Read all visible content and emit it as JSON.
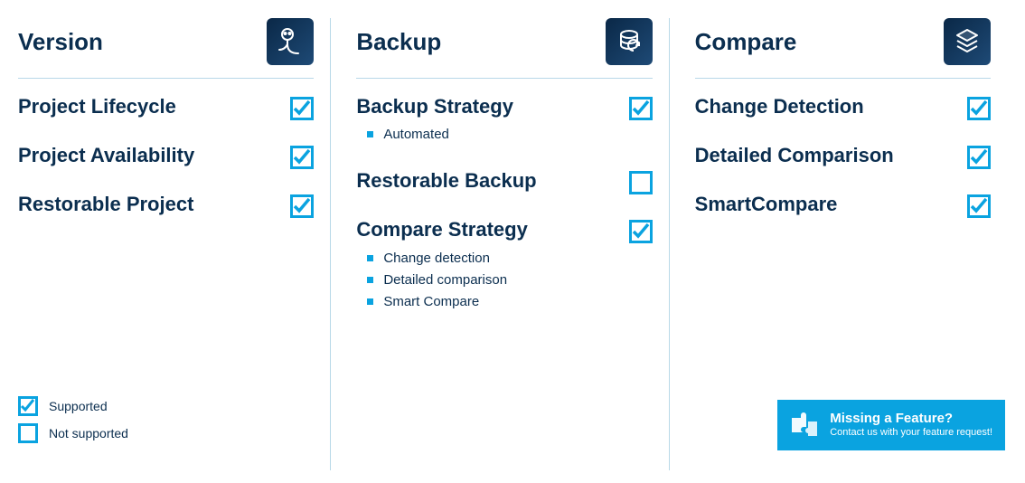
{
  "columns": [
    {
      "title": "Version",
      "icon": "robot-icon",
      "features": [
        {
          "label": "Project Lifecycle",
          "supported": true,
          "sub": []
        },
        {
          "label": "Project Availability",
          "supported": true,
          "sub": []
        },
        {
          "label": "Restorable Project",
          "supported": true,
          "sub": []
        }
      ]
    },
    {
      "title": "Backup",
      "icon": "database-restore-icon",
      "features": [
        {
          "label": "Backup Strategy",
          "supported": true,
          "sub": [
            "Automated"
          ]
        },
        {
          "label": "Restorable Backup",
          "supported": false,
          "sub": []
        },
        {
          "label": "Compare Strategy",
          "supported": true,
          "sub": [
            "Change detection",
            "Detailed comparison",
            "Smart Compare"
          ]
        }
      ]
    },
    {
      "title": "Compare",
      "icon": "layers-icon",
      "features": [
        {
          "label": "Change Detection",
          "supported": true,
          "sub": []
        },
        {
          "label": "Detailed Comparison",
          "supported": true,
          "sub": []
        },
        {
          "label": "SmartCompare",
          "supported": true,
          "sub": []
        }
      ]
    }
  ],
  "legend": {
    "supported": "Supported",
    "not_supported": "Not supported"
  },
  "cta": {
    "title": "Missing a Feature?",
    "subtitle": "Contact us with your feature request!"
  }
}
